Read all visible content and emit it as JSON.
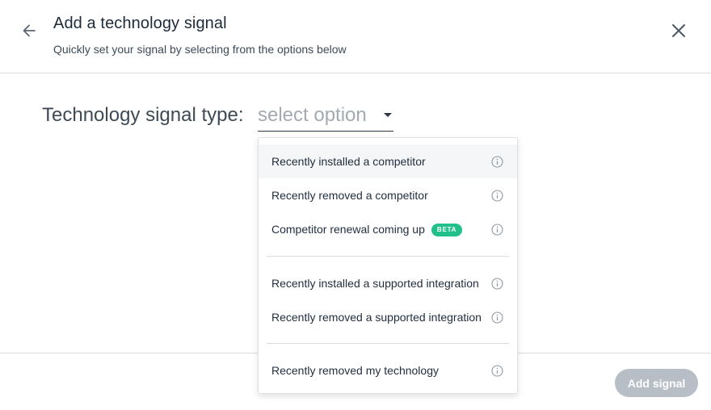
{
  "header": {
    "title": "Add a technology signal",
    "subtitle": "Quickly set your signal by selecting from the options below"
  },
  "form": {
    "type_label": "Technology signal type:",
    "select_placeholder": "select option"
  },
  "dropdown": {
    "options": [
      {
        "label": "Recently installed a competitor",
        "badge": "",
        "hovered": true
      },
      {
        "label": "Recently removed a competitor",
        "badge": ""
      },
      {
        "label": "Competitor renewal coming up",
        "badge": "BETA"
      },
      {
        "label": "Recently installed a supported integration",
        "badge": ""
      },
      {
        "label": "Recently removed a supported integration",
        "badge": ""
      },
      {
        "label": "Recently removed my technology",
        "badge": ""
      }
    ]
  },
  "footer": {
    "add_label": "Add signal"
  },
  "colors": {
    "beta_badge": "#21c08b",
    "disabled_button": "#b7bec6",
    "placeholder": "#a3aab2"
  },
  "icons": {
    "back": "arrow-left-icon",
    "close": "close-icon",
    "info": "info-icon",
    "caret": "caret-down-icon"
  }
}
